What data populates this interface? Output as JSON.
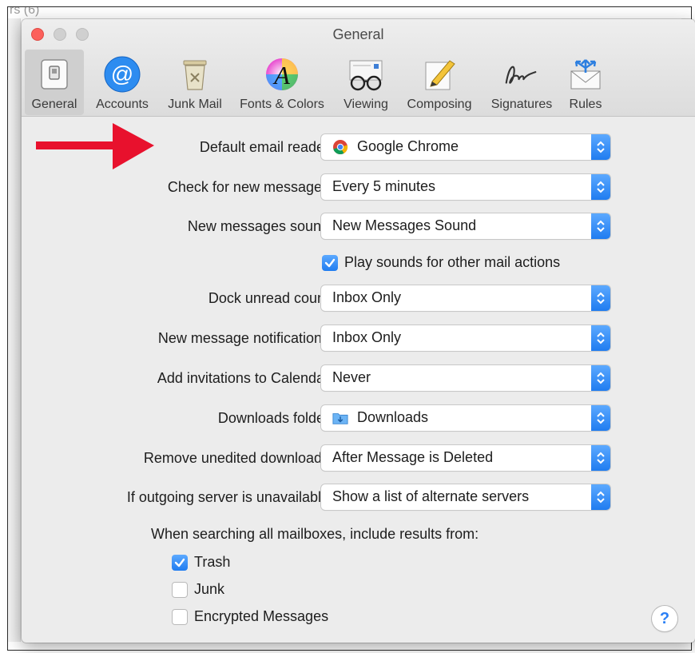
{
  "background_window": {
    "title_fragment": "rs (6)"
  },
  "window": {
    "title": "General"
  },
  "toolbar": {
    "items": [
      {
        "label": "General",
        "icon": "general-switch-icon",
        "selected": true
      },
      {
        "label": "Accounts",
        "icon": "at-sign-icon"
      },
      {
        "label": "Junk Mail",
        "icon": "trash-can-icon"
      },
      {
        "label": "Fonts & Colors",
        "icon": "fonts-colors-icon"
      },
      {
        "label": "Viewing",
        "icon": "glasses-icon"
      },
      {
        "label": "Composing",
        "icon": "pencil-paper-icon"
      },
      {
        "label": "Signatures",
        "icon": "signature-icon"
      },
      {
        "label": "Rules",
        "icon": "rules-envelope-icon"
      }
    ]
  },
  "settings": {
    "default_reader": {
      "label": "Default email reader:",
      "value": "Google Chrome",
      "icon": "chrome-icon"
    },
    "check_messages": {
      "label": "Check for new messages:",
      "value": "Every 5 minutes"
    },
    "new_sound": {
      "label": "New messages sound:",
      "value": "New Messages Sound"
    },
    "play_sounds": {
      "label": "Play sounds for other mail actions",
      "checked": true
    },
    "dock_unread": {
      "label": "Dock unread count:",
      "value": "Inbox Only"
    },
    "notifications": {
      "label": "New message notifications:",
      "value": "Inbox Only"
    },
    "invitations": {
      "label": "Add invitations to Calendar:",
      "value": "Never"
    },
    "downloads_folder": {
      "label": "Downloads folder:",
      "value": "Downloads",
      "icon": "downloads-folder-icon"
    },
    "remove_downloads": {
      "label": "Remove unedited downloads:",
      "value": "After Message is Deleted"
    },
    "outgoing_server": {
      "label": "If outgoing server is unavailable:",
      "value": "Show a list of alternate servers"
    }
  },
  "search_section": {
    "heading": "When searching all mailboxes, include results from:",
    "options": [
      {
        "label": "Trash",
        "checked": true
      },
      {
        "label": "Junk",
        "checked": false
      },
      {
        "label": "Encrypted Messages",
        "checked": false
      }
    ]
  },
  "help": {
    "label": "?"
  },
  "colors": {
    "accent": "#1f7cf0",
    "annotation_arrow": "#e8112d",
    "close_button": "#fc605b"
  }
}
